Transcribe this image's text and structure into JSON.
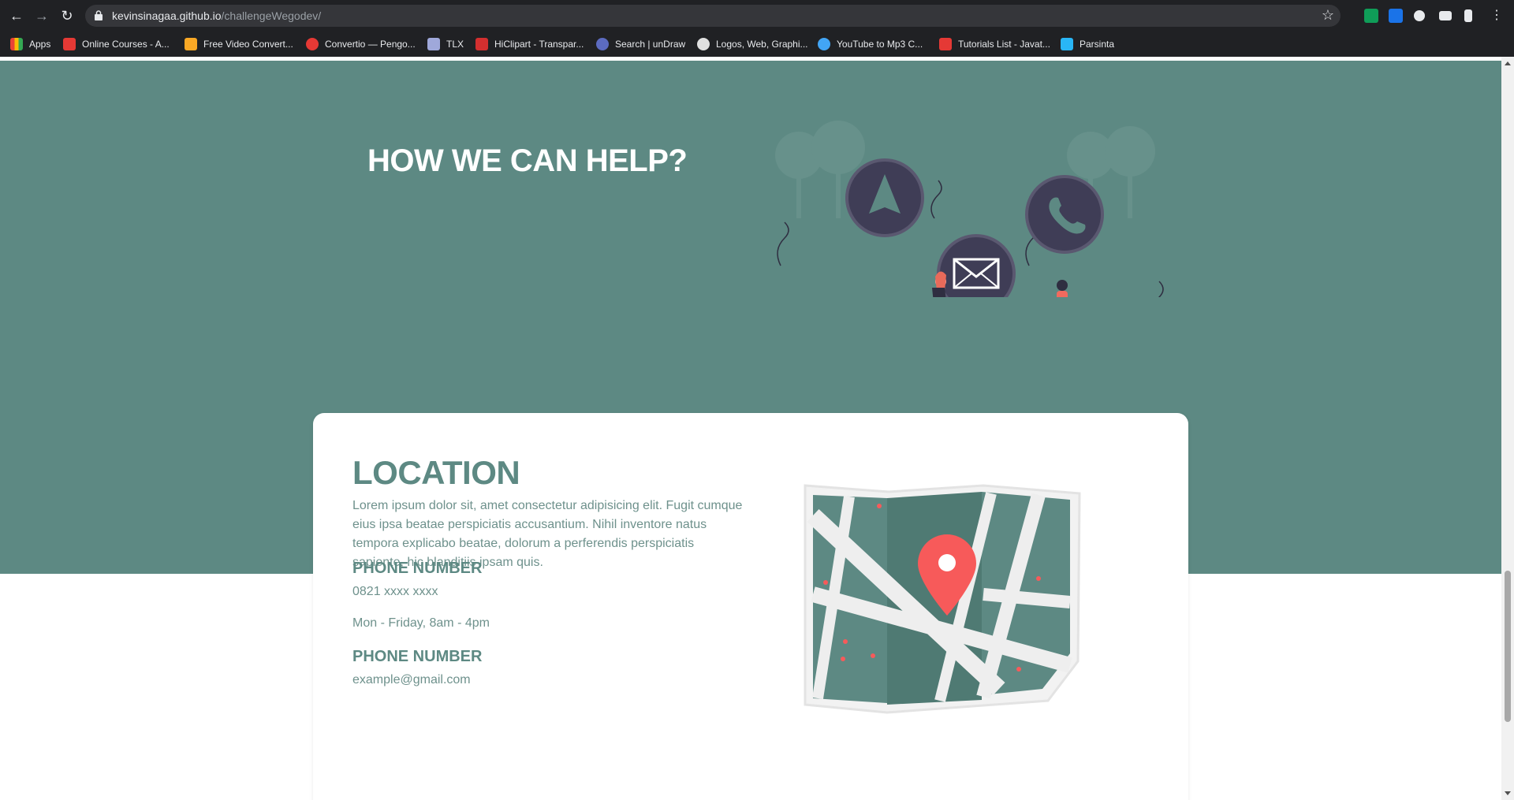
{
  "browser": {
    "url_host": "kevinsinagaa.github.io",
    "url_path": "/challengeWegodev/",
    "bookmarks": [
      {
        "label": "Apps",
        "color": "#ea4335"
      },
      {
        "label": "Online Courses - A...",
        "color": "#e53935"
      },
      {
        "label": "Free Video Convert...",
        "color": "#f9a825"
      },
      {
        "label": "Convertio — Pengo...",
        "color": "#e53935"
      },
      {
        "label": "TLX",
        "color": "#9fa8da"
      },
      {
        "label": "HiClipart - Transpar...",
        "color": "#d32f2f"
      },
      {
        "label": "Search | unDraw",
        "color": "#5c6bc0"
      },
      {
        "label": "Logos, Web, Graphi...",
        "color": "#e0e0e0"
      },
      {
        "label": "YouTube to Mp3 C...",
        "color": "#42a5f5"
      },
      {
        "label": "Tutorials List - Javat...",
        "color": "#e53935"
      },
      {
        "label": "Parsinta",
        "color": "#29b6f6"
      }
    ]
  },
  "hero": {
    "title": "HOW WE CAN HELP?"
  },
  "location": {
    "title": "LOCATION",
    "description": "Lorem ipsum dolor sit, amet consectetur adipisicing elit. Fugit cumque eius ipsa beatae perspiciatis accusantium. Nihil inventore natus tempora explicabo beatae, dolorum a perferendis perspiciatis sapiente, hic blanditiis ipsam quis.",
    "phone_label": "PHONE NUMBER",
    "phone_value": "0821 xxxx xxxx",
    "hours": "Mon - Friday, 8am - 4pm",
    "email_label": "PHONE NUMBER",
    "email_value": "example@gmail.com"
  },
  "colors": {
    "accent": "#5d8983",
    "pin": "#f75a5a",
    "icon_circle": "#3f3d56"
  }
}
